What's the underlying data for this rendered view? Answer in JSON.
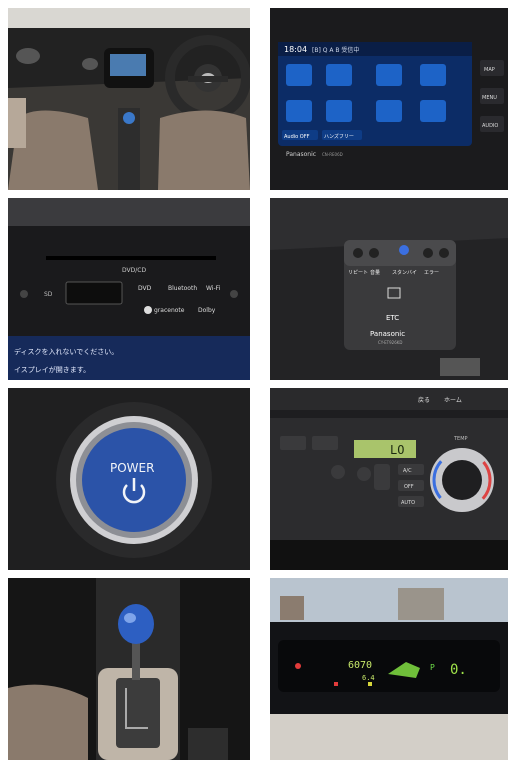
{
  "photos": [
    {
      "subject": "dashboard-interior"
    },
    {
      "subject": "navigation-head-unit"
    },
    {
      "subject": "cd-dvd-slot"
    },
    {
      "subject": "etc-reader"
    },
    {
      "subject": "power-button"
    },
    {
      "subject": "climate-control"
    },
    {
      "subject": "shift-lever"
    },
    {
      "subject": "instrument-cluster"
    }
  ],
  "nav": {
    "clock": "18:04",
    "header": "[B] Q A B 受信中",
    "menu_labels": [
      "MAP",
      "MENU",
      "AUDIO"
    ],
    "bottom_left": "Audio OFF",
    "bottom_mid": "ハンズフリー",
    "brand": "Panasonic",
    "model": "CN-RE06D"
  },
  "cd": {
    "label": "DVD/CD",
    "sd": "SD",
    "logos": [
      "DVD",
      "Bluetooth",
      "Wi-Fi",
      "gracenote",
      "Dolby"
    ],
    "warning_text": "ディスクを入れないでください。",
    "warning_text2": "イスプレイが開きます。"
  },
  "etc": {
    "label": "ETC",
    "brand": "Panasonic",
    "model": "CY-ET926KD",
    "labels": [
      "リピート",
      "音量",
      "スタンバイ",
      "エラー"
    ]
  },
  "power": {
    "label": "POWER"
  },
  "climate": {
    "display": "LO",
    "buttons": [
      "A/C",
      "OFF",
      "AUTO"
    ],
    "temp_label": "TEMP",
    "nav_top": [
      "戻る",
      "ホーム"
    ]
  },
  "cluster": {
    "odo": "6070",
    "fuel": "6.4",
    "gear_p": "P",
    "speed": "0."
  }
}
